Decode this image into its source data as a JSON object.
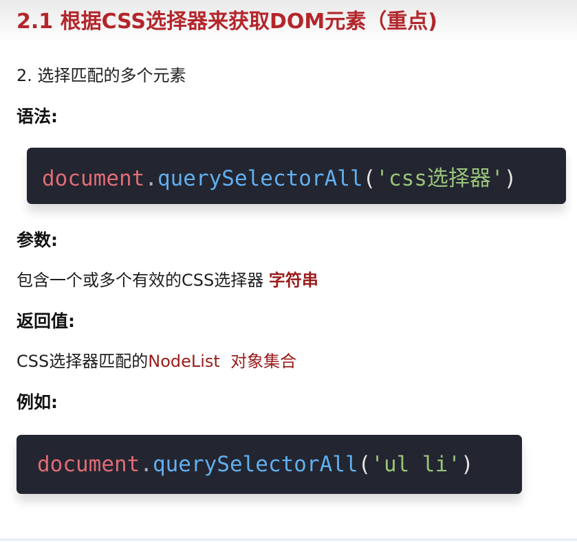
{
  "title": "2.1 根据CSS选择器来获取DOM元素（重点)",
  "subtitle": "2. 选择匹配的多个元素",
  "syntax": {
    "label": "语法:",
    "code": {
      "object": "document",
      "dot": ".",
      "method": "querySelectorAll",
      "open": "(",
      "argument": "'css选择器'",
      "close": ")"
    }
  },
  "params": {
    "label": "参数:",
    "text": "包含一个或多个有效的CSS选择器 ",
    "highlight": "字符串"
  },
  "return_value": {
    "label": "返回值:",
    "text": "CSS选择器匹配的",
    "highlight": "NodeList  对象集合"
  },
  "example": {
    "label": "例如:",
    "code": {
      "object": "document",
      "dot": ".",
      "method": "querySelectorAll",
      "open": "(",
      "argument": "'ul li'",
      "close": ")"
    }
  },
  "colors": {
    "title": "#b3262b",
    "accent": "#9a1c1c",
    "code_background": "#232530",
    "code_object": "#e06c75",
    "code_method": "#61afef",
    "code_string": "#98c379"
  }
}
